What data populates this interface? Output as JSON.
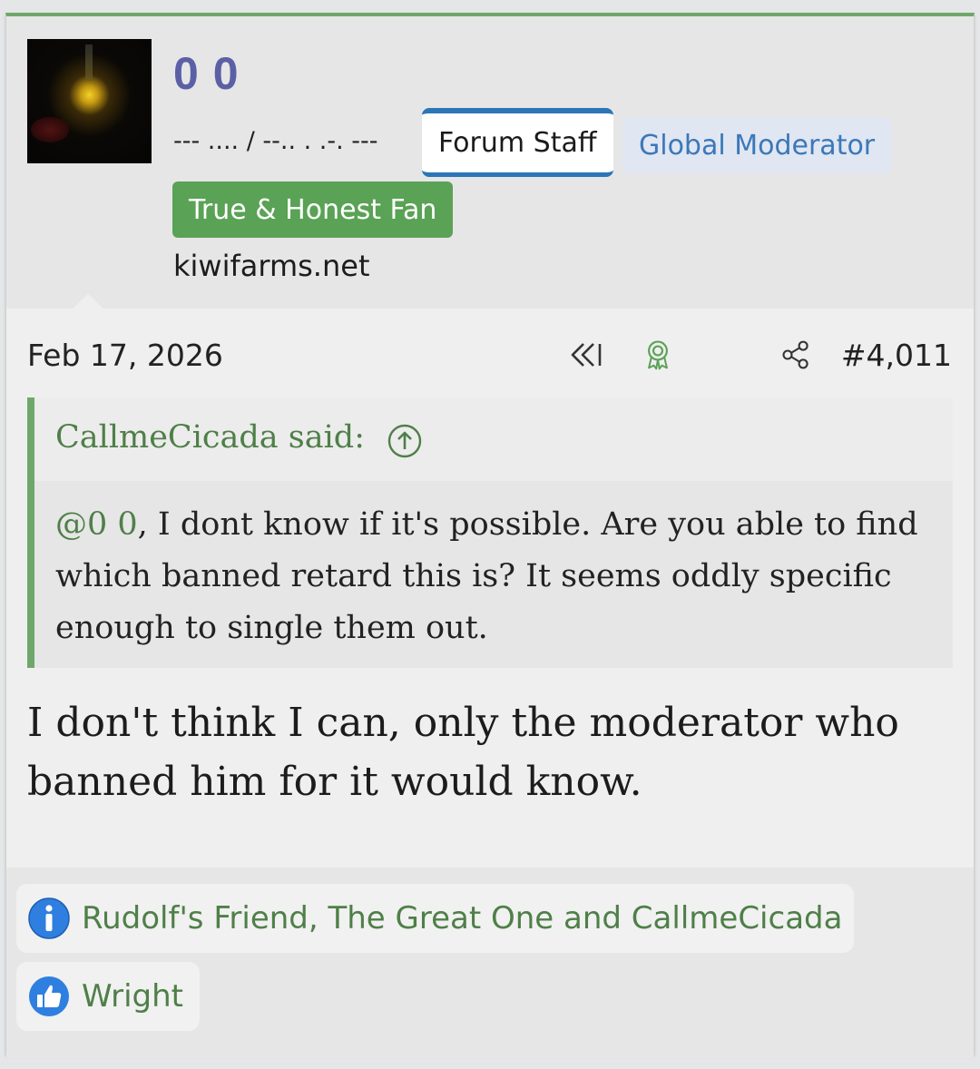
{
  "user": {
    "name": "0 0",
    "title": "--- .... / --.. . .-. ---",
    "badges": {
      "staff": "Forum Staff",
      "global_mod": "Global Moderator",
      "fan": "True & Honest Fan"
    },
    "site": "kiwifarms.net"
  },
  "post": {
    "date": "Feb 17, 2026",
    "number": "#4,011",
    "icons": [
      "rewind-icon",
      "award-ribbon-icon",
      "share-icon"
    ]
  },
  "quote": {
    "author_label": "CallmeCicada said:",
    "mention": "@0 0",
    "text": ", I dont know if it's possible. Are you able to find which banned retard this is? It seems oddly specific enough to single them out."
  },
  "reply": {
    "text": "I don't think I can, only the moderator who banned him for it would know."
  },
  "reactions": [
    {
      "icon": "info-icon",
      "label": "Rudolf's Friend, The Great One and CallmeCicada"
    },
    {
      "icon": "thumbs-up-icon",
      "label": "Wright"
    }
  ],
  "colors": {
    "accent_green": "#6fa76a",
    "username": "#5b60a6",
    "staff_border": "#2a76b6",
    "fan_badge": "#5aa255"
  }
}
